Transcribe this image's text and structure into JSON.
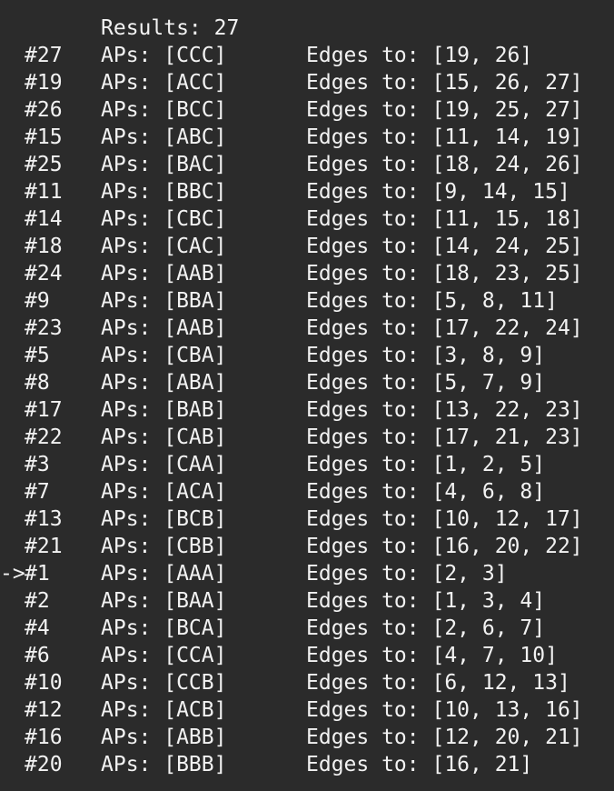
{
  "terminal": {
    "header": "Results: 27",
    "cursor_marker": "->",
    "rows": [
      {
        "id": "#27",
        "aps": "APs: [CCC]",
        "edges": "Edges to: [19, 26]",
        "current": false
      },
      {
        "id": "#19",
        "aps": "APs: [ACC]",
        "edges": "Edges to: [15, 26, 27]",
        "current": false
      },
      {
        "id": "#26",
        "aps": "APs: [BCC]",
        "edges": "Edges to: [19, 25, 27]",
        "current": false
      },
      {
        "id": "#15",
        "aps": "APs: [ABC]",
        "edges": "Edges to: [11, 14, 19]",
        "current": false
      },
      {
        "id": "#25",
        "aps": "APs: [BAC]",
        "edges": "Edges to: [18, 24, 26]",
        "current": false
      },
      {
        "id": "#11",
        "aps": "APs: [BBC]",
        "edges": "Edges to: [9, 14, 15]",
        "current": false
      },
      {
        "id": "#14",
        "aps": "APs: [CBC]",
        "edges": "Edges to: [11, 15, 18]",
        "current": false
      },
      {
        "id": "#18",
        "aps": "APs: [CAC]",
        "edges": "Edges to: [14, 24, 25]",
        "current": false
      },
      {
        "id": "#24",
        "aps": "APs: [AAB]",
        "edges": "Edges to: [18, 23, 25]",
        "current": false
      },
      {
        "id": "#9",
        "aps": "APs: [BBA]",
        "edges": "Edges to: [5, 8, 11]",
        "current": false
      },
      {
        "id": "#23",
        "aps": "APs: [AAB]",
        "edges": "Edges to: [17, 22, 24]",
        "current": false
      },
      {
        "id": "#5",
        "aps": "APs: [CBA]",
        "edges": "Edges to: [3, 8, 9]",
        "current": false
      },
      {
        "id": "#8",
        "aps": "APs: [ABA]",
        "edges": "Edges to: [5, 7, 9]",
        "current": false
      },
      {
        "id": "#17",
        "aps": "APs: [BAB]",
        "edges": "Edges to: [13, 22, 23]",
        "current": false
      },
      {
        "id": "#22",
        "aps": "APs: [CAB]",
        "edges": "Edges to: [17, 21, 23]",
        "current": false
      },
      {
        "id": "#3",
        "aps": "APs: [CAA]",
        "edges": "Edges to: [1, 2, 5]",
        "current": false
      },
      {
        "id": "#7",
        "aps": "APs: [ACA]",
        "edges": "Edges to: [4, 6, 8]",
        "current": false
      },
      {
        "id": "#13",
        "aps": "APs: [BCB]",
        "edges": "Edges to: [10, 12, 17]",
        "current": false
      },
      {
        "id": "#21",
        "aps": "APs: [CBB]",
        "edges": "Edges to: [16, 20, 22]",
        "current": false
      },
      {
        "id": "#1",
        "aps": "APs: [AAA]",
        "edges": "Edges to: [2, 3]",
        "current": true
      },
      {
        "id": "#2",
        "aps": "APs: [BAA]",
        "edges": "Edges to: [1, 3, 4]",
        "current": false
      },
      {
        "id": "#4",
        "aps": "APs: [BCA]",
        "edges": "Edges to: [2, 6, 7]",
        "current": false
      },
      {
        "id": "#6",
        "aps": "APs: [CCA]",
        "edges": "Edges to: [4, 7, 10]",
        "current": false
      },
      {
        "id": "#10",
        "aps": "APs: [CCB]",
        "edges": "Edges to: [6, 12, 13]",
        "current": false
      },
      {
        "id": "#12",
        "aps": "APs: [ACB]",
        "edges": "Edges to: [10, 13, 16]",
        "current": false
      },
      {
        "id": "#16",
        "aps": "APs: [ABB]",
        "edges": "Edges to: [12, 20, 21]",
        "current": false
      },
      {
        "id": "#20",
        "aps": "APs: [BBB]",
        "edges": "Edges to: [16, 21]",
        "current": false
      }
    ]
  },
  "colors": {
    "background": "#2b2b2b",
    "text": "#f2f2f2"
  }
}
